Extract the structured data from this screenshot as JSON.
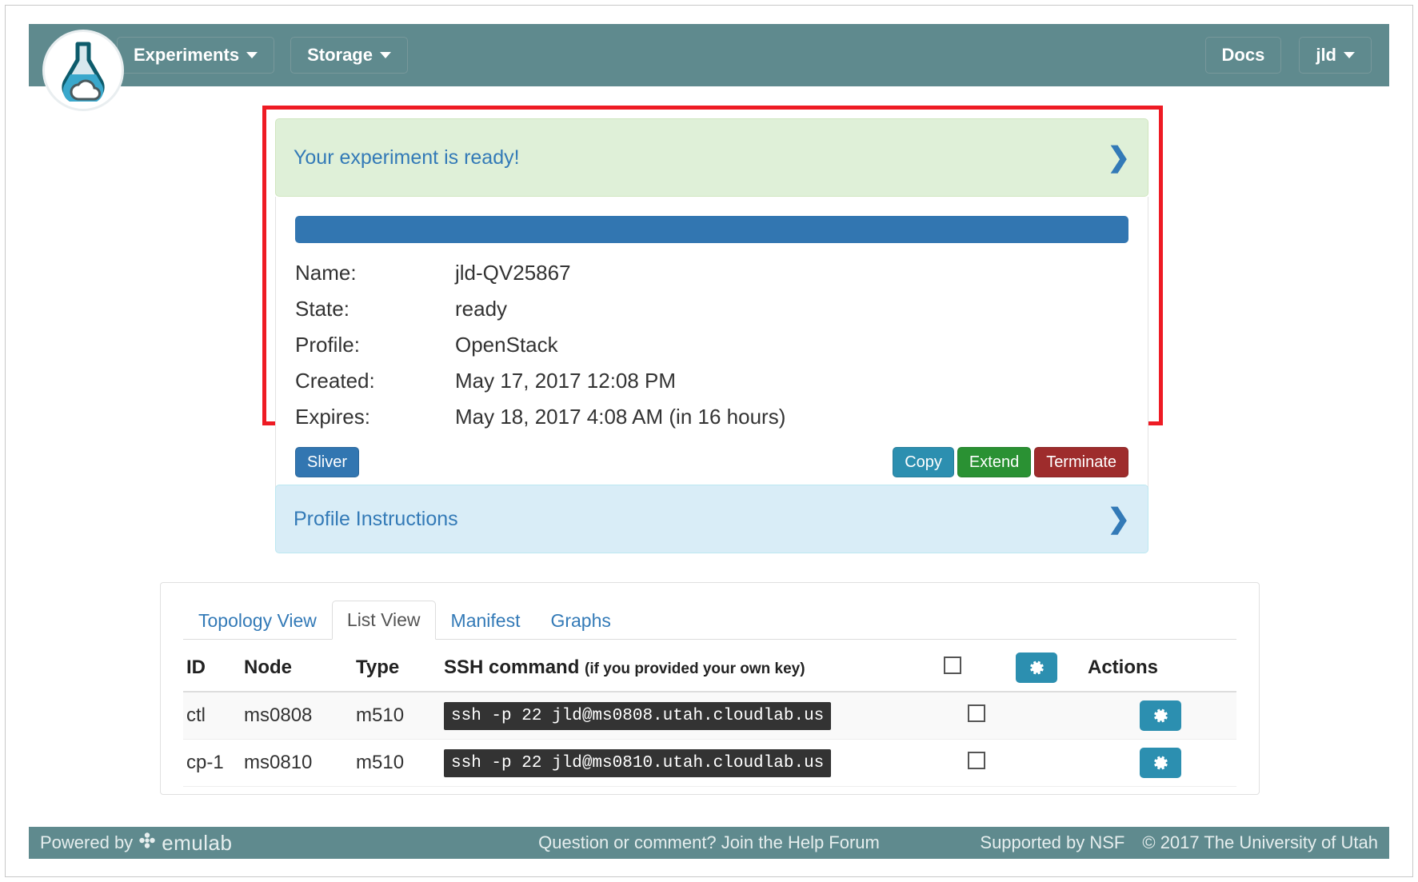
{
  "navbar": {
    "logo_icon": "flask-cloud-logo-icon",
    "left_items": [
      {
        "label": "Experiments",
        "icon": "chevron-down-icon"
      },
      {
        "label": "Storage",
        "icon": "chevron-down-icon"
      }
    ],
    "right_items": [
      {
        "label": "Docs",
        "icon": ""
      },
      {
        "label": "jld",
        "icon": "chevron-down-icon"
      }
    ],
    "bg_color": "#5f8a8e"
  },
  "status_panel": {
    "heading": "Your experiment is ready!",
    "expand_icon": "chevron-right-icon",
    "progress_percent": 100,
    "progress_color": "#3276b1",
    "rows": [
      {
        "label": "Name:",
        "value": "jld-QV25867",
        "style": "plain"
      },
      {
        "label": "State:",
        "value": "ready",
        "style": "ready"
      },
      {
        "label": "Profile:",
        "value": "OpenStack",
        "style": "link"
      },
      {
        "label": "Created:",
        "value": "May 17, 2017 12:08 PM",
        "style": "plain"
      },
      {
        "label": "Expires:",
        "value": "May 18, 2017 4:08 AM (in 16 hours)",
        "style": "plain"
      }
    ],
    "sliver_button": "Sliver",
    "actions": [
      {
        "label": "Copy",
        "color": "#2c8fb0"
      },
      {
        "label": "Extend",
        "color": "#2a9133"
      },
      {
        "label": "Terminate",
        "color": "#9e2c2c"
      }
    ],
    "highlight_color": "#ee1b24"
  },
  "profile_instructions": {
    "heading": "Profile Instructions",
    "expand_icon": "chevron-right-icon"
  },
  "list_view": {
    "tabs": [
      {
        "label": "Topology View",
        "active": false
      },
      {
        "label": "List View",
        "active": true
      },
      {
        "label": "Manifest",
        "active": false
      },
      {
        "label": "Graphs",
        "active": false
      }
    ],
    "columns": {
      "id": "ID",
      "node": "Node",
      "type": "Type",
      "ssh": "SSH command",
      "ssh_note": "(if you provided your own key)",
      "actions": "Actions"
    },
    "header_checkbox_checked": false,
    "header_gear_icon": "gear-icon",
    "rows": [
      {
        "id": "ctl",
        "node": "ms0808",
        "type": "m510",
        "ssh": "ssh -p 22 jld@ms0808.utah.cloudlab.us",
        "checked": false,
        "action_icon": "gear-icon"
      },
      {
        "id": "cp-1",
        "node": "ms0810",
        "type": "m510",
        "ssh": "ssh -p 22 jld@ms0810.utah.cloudlab.us",
        "checked": false,
        "action_icon": "gear-icon"
      }
    ]
  },
  "footer": {
    "powered_by": "Powered by",
    "emulab": "emulab",
    "emulab_icon": "emulab-flower-icon",
    "help": "Question or comment? Join the Help Forum",
    "nsf": "Supported by NSF",
    "copyright": "© 2017 The University of Utah"
  }
}
